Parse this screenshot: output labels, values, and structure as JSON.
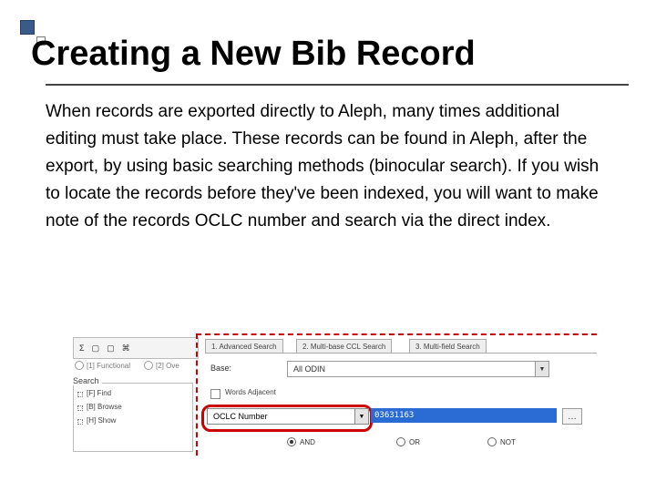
{
  "title": "Creating a New Bib Record",
  "body": "When records are exported directly to Aleph, many times additional editing must take place.  These records can be found in Aleph, after the export, by using basic searching methods (binocular search).  If you wish to locate the records before they've been indexed, you will want to make note of the records OCLC number and search via the direct index.",
  "left": {
    "radio1": "[1] Functional",
    "radio2": "[2] Ove",
    "search_hdr": "Search",
    "items": [
      "[F] Find",
      "[B] Browse",
      "[H] Show"
    ]
  },
  "main": {
    "tabs": [
      "1. Advanced Search",
      "2. Multi-base CCL Search",
      "3. Multi-field Search"
    ],
    "base_label": "Base:",
    "base_value": "All ODIN",
    "adjacent_label": "Words Adjacent",
    "field_dropdown": "OCLC Number",
    "field_value": "03631163",
    "dots": "…",
    "logic": {
      "and": "AND",
      "or": "OR",
      "not": "NOT"
    }
  }
}
